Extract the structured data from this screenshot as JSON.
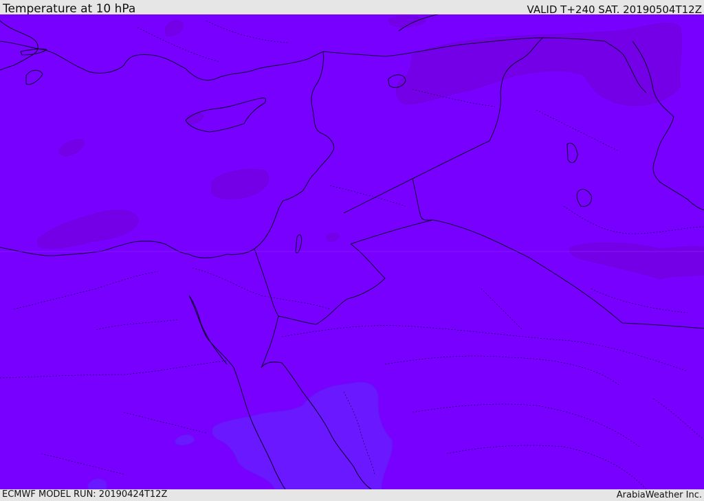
{
  "header": {
    "title": "Temperature at 10 hPa",
    "valid": "VALID T+240 SAT. 20190504T12Z"
  },
  "footer": {
    "model_run": "ECMWF MODEL RUN: 20190424T12Z",
    "credit": "ArabiaWeather Inc."
  },
  "map": {
    "colors": {
      "base_field": "#7800ff",
      "warm_patch": "#7300e6",
      "cool_patch": "#6a18ff",
      "coastline": "#14003c",
      "border": "#0f0030"
    }
  }
}
